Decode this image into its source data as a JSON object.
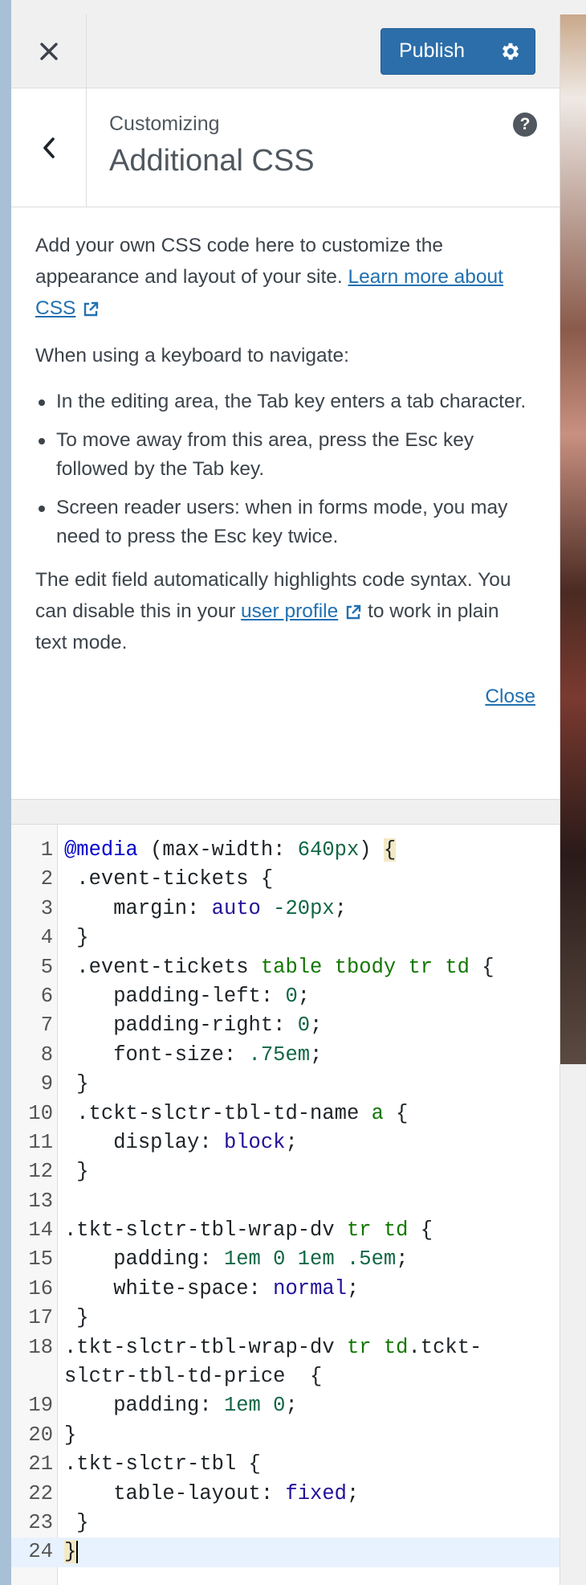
{
  "header": {
    "close_label": "×",
    "publish_label": "Publish"
  },
  "section": {
    "customizing": "Customizing",
    "title": "Additional CSS",
    "help": "?"
  },
  "description": {
    "intro": "Add your own CSS code here to customize the appearance and layout of your site.",
    "learn_more_link": "Learn more about CSS",
    "keyboard_heading": "When using a keyboard to navigate:",
    "bullets": [
      "In the editing area, the Tab key enters a tab character.",
      "To move away from this area, press the Esc key followed by the Tab key.",
      "Screen reader users: when in forms mode, you may need to press the Esc key twice."
    ],
    "syntax_note_before": "The edit field automatically highlights code syntax. You can disable this in your",
    "user_profile_link": "user profile",
    "syntax_note_after": "to work in plain text mode.",
    "close_link": "Close"
  },
  "code_lines": [
    {
      "n": "1"
    },
    {
      "n": "2"
    },
    {
      "n": "3"
    },
    {
      "n": "4"
    },
    {
      "n": "5"
    },
    {
      "n": "6"
    },
    {
      "n": "7"
    },
    {
      "n": "8"
    },
    {
      "n": "9"
    },
    {
      "n": "10"
    },
    {
      "n": "11"
    },
    {
      "n": "12"
    },
    {
      "n": "13"
    },
    {
      "n": "14"
    },
    {
      "n": "15"
    },
    {
      "n": "16"
    },
    {
      "n": "17"
    },
    {
      "n": "18"
    },
    {
      "n": "19"
    },
    {
      "n": "20"
    },
    {
      "n": "21"
    },
    {
      "n": "22"
    },
    {
      "n": "23"
    },
    {
      "n": "24"
    }
  ],
  "code": {
    "l1_kw": "@media",
    "l1_rest": " (max-width: ",
    "l1_num": "640px",
    "l1_close": ") ",
    "l1_brace": "{",
    "l2": " .event-tickets {",
    "l3_prop": "    margin: ",
    "l3_atom": "auto",
    "l3_sp": " ",
    "l3_num": "-20px",
    "l3_end": ";",
    "l4": " }",
    "l5_sel": " .event-tickets ",
    "l5_tags": "table tbody tr td",
    "l5_brace": " {",
    "l6_prop": "    padding-left: ",
    "l6_num": "0",
    "l6_end": ";",
    "l7_prop": "    padding-right: ",
    "l7_num": "0",
    "l7_end": ";",
    "l8_prop": "    font-size: ",
    "l8_num": ".75em",
    "l8_end": ";",
    "l9": " }",
    "l10_sel": " .tckt-slctr-tbl-td-name ",
    "l10_tag": "a",
    "l10_brace": " {",
    "l11_prop": "    display: ",
    "l11_atom": "block",
    "l11_end": ";",
    "l12": " }",
    "l13": "",
    "l14_sel": ".tkt-slctr-tbl-wrap-dv ",
    "l14_tags": "tr td",
    "l14_brace": " {",
    "l15_prop": "    padding: ",
    "l15_nums": "1em 0 1em .5em",
    "l15_end": ";",
    "l16_prop": "    white-space: ",
    "l16_atom": "normal",
    "l16_end": ";",
    "l17": " }",
    "l18_sel": ".tkt-slctr-tbl-wrap-dv ",
    "l18_tags": "tr td",
    "l18_rest": ".tckt-",
    "l18b": "slctr-tbl-td-price  {",
    "l19_prop": "    padding: ",
    "l19_nums": "1em 0",
    "l19_end": ";",
    "l20": "}",
    "l21": ".tkt-slctr-tbl {",
    "l22_prop": "    table-layout: ",
    "l22_atom": "fixed",
    "l22_end": ";",
    "l23": " }",
    "l24": "}"
  }
}
